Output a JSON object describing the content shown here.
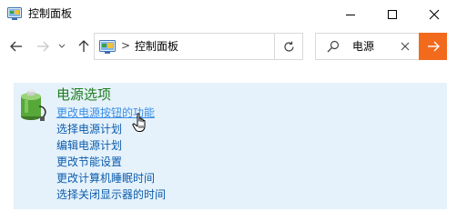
{
  "window": {
    "title": "控制面板"
  },
  "address": {
    "path": "控制面板",
    "separator": ">"
  },
  "search": {
    "value": "电源"
  },
  "colors": {
    "heading": "#1e7d1e",
    "link": "#0b5cad",
    "accent": "#f26a1b",
    "result_bg": "#e6f2fb"
  },
  "result": {
    "heading": "电源选项",
    "links": [
      "更改电源按钮的功能",
      "选择电源计划",
      "编辑电源计划",
      "更改节能设置",
      "更改计算机睡眠时间",
      "选择关闭显示器的时间"
    ],
    "hovered_index": 0
  }
}
